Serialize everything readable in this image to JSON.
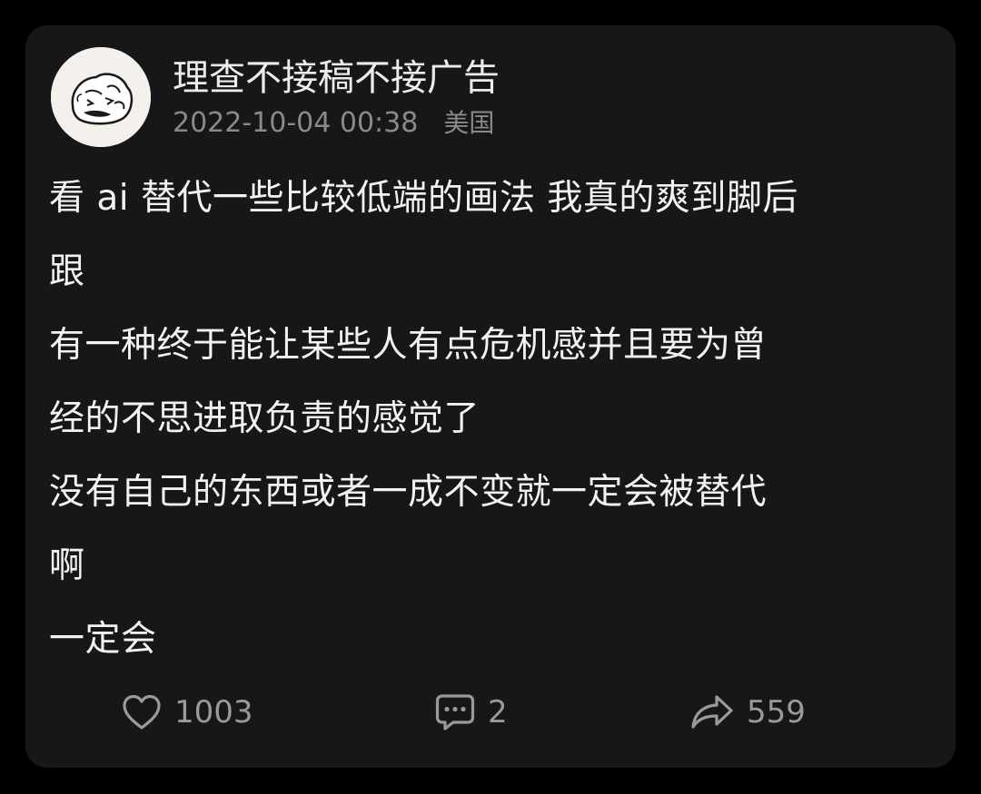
{
  "post": {
    "author": "理查不接稿不接广告",
    "timestamp": "2022-10-04 00:38",
    "location": "美国",
    "lines": [
      "看 ai 替代一些比较低端的画法 我真的爽到脚后",
      "跟",
      "有一种终于能让某些人有点危机感并且要为曾",
      "经的不思进取负责的感觉了",
      "没有自己的东西或者一成不变就一定会被替代",
      "啊",
      "一定会"
    ]
  },
  "actions": {
    "likes": "1003",
    "comments": "2",
    "shares": "559"
  },
  "icons": {
    "like": "heart-icon",
    "comment": "comment-bubble-icon",
    "share": "share-arrow-icon"
  },
  "colors": {
    "background": "#000000",
    "card": "#171717",
    "text": "#f2f2f2",
    "muted": "#8a8a8a"
  }
}
